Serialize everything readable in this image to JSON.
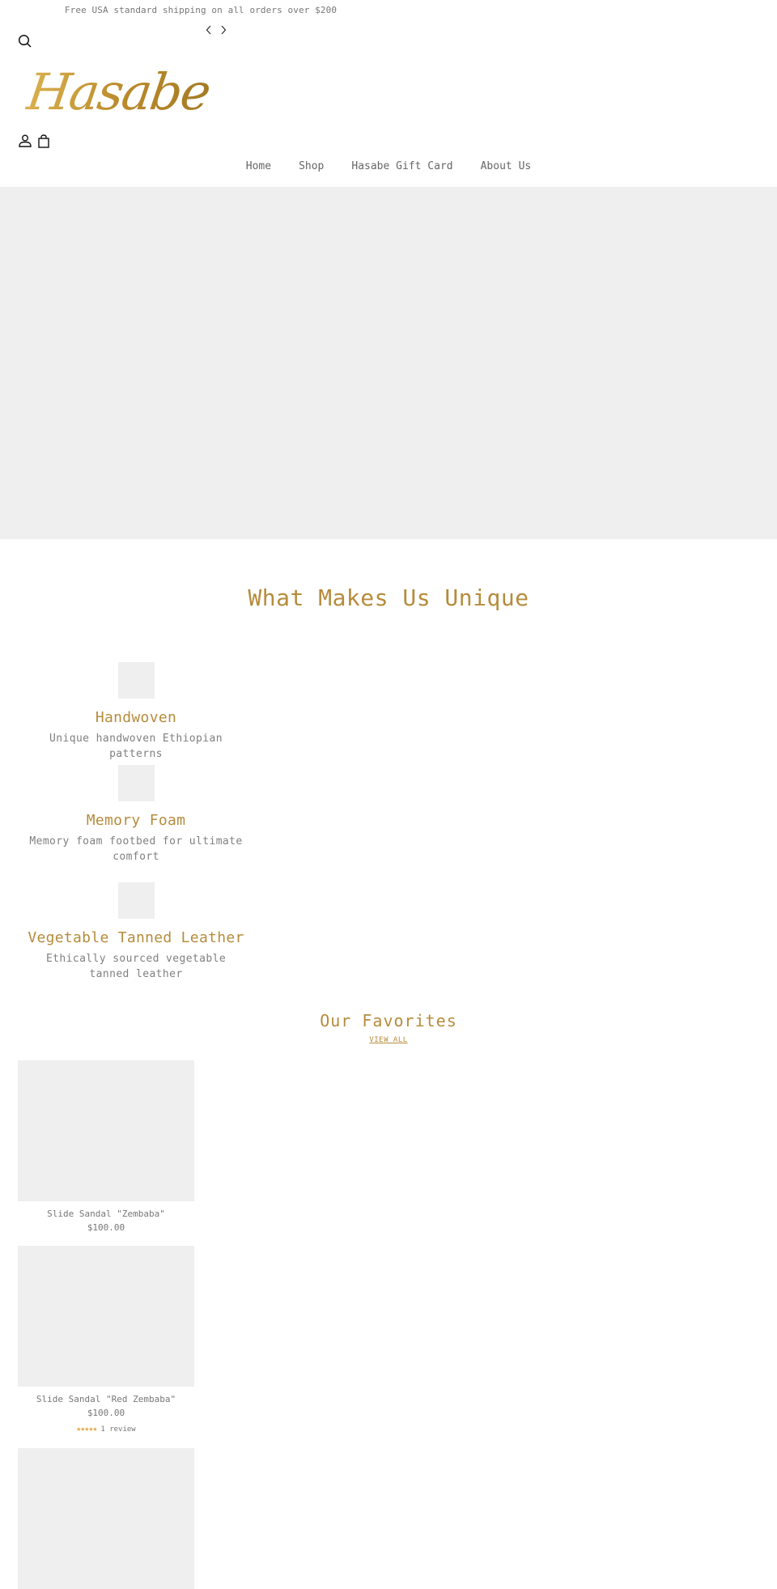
{
  "announcement": {
    "text": "Free USA standard shipping on all orders over $200",
    "prev_icon": "chevron-left-icon",
    "next_icon": "chevron-right-icon"
  },
  "header": {
    "logo_text": "Hasabe",
    "search_icon": "search-icon",
    "account_icon": "user-icon",
    "cart_icon": "shopping-bag-icon"
  },
  "nav": {
    "items": [
      {
        "label": "Home"
      },
      {
        "label": "Shop"
      },
      {
        "label": "Hasabe Gift Card"
      },
      {
        "label": "About Us"
      }
    ]
  },
  "colors": {
    "accent": "#b68c3c",
    "placeholder": "#efefef",
    "text": "#777777",
    "stars": "#e0a84a"
  },
  "unique": {
    "title": "What Makes Us Unique",
    "features": [
      {
        "title": "Handwoven",
        "text": "Unique handwoven Ethiopian patterns"
      },
      {
        "title": "Memory Foam",
        "text": "Memory foam footbed for ultimate comfort"
      },
      {
        "title": "Vegetable Tanned Leather",
        "text": "Ethically sourced vegetable tanned leather"
      }
    ]
  },
  "favorites": {
    "title": "Our Favorites",
    "view_all": "VIEW ALL",
    "products": [
      {
        "name": "Slide Sandal \"Zembaba\"",
        "price": "$100.00"
      },
      {
        "name": "Slide Sandal \"Red Zembaba\"",
        "price": "$100.00",
        "rating": 5,
        "stars": "★★★★★",
        "reviews": "1 review"
      },
      {
        "name": "",
        "price": ""
      }
    ]
  }
}
